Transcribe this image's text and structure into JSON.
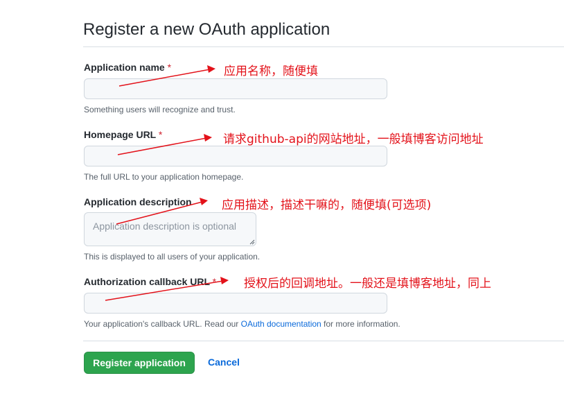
{
  "page": {
    "title": "Register a new OAuth application"
  },
  "form": {
    "app_name": {
      "label": "Application name",
      "required_mark": "*",
      "value": "",
      "hint": "Something users will recognize and trust."
    },
    "homepage_url": {
      "label": "Homepage URL",
      "required_mark": "*",
      "value": "",
      "hint": "The full URL to your application homepage."
    },
    "description": {
      "label": "Application description",
      "placeholder": "Application description is optional",
      "hint": "This is displayed to all users of your application."
    },
    "callback_url": {
      "label": "Authorization callback URL",
      "required_mark": "*",
      "value": "",
      "hint_before": "Your application's callback URL. Read our ",
      "hint_link": "OAuth documentation",
      "hint_after": " for more information."
    }
  },
  "actions": {
    "register_label": "Register application",
    "cancel_label": "Cancel"
  },
  "annotations": {
    "note_1": "应用名称，随便填",
    "note_2": "请求github-api的网站地址，一般填博客访问地址",
    "note_3": "应用描述，描述干嘛的，随便填(可选项)",
    "note_4": "授权后的回调地址。一般还是填博客地址，同上",
    "color": "#e3121a"
  },
  "colors": {
    "primary_button": "#2da44e",
    "link": "#0969da",
    "required": "#cf222e"
  }
}
